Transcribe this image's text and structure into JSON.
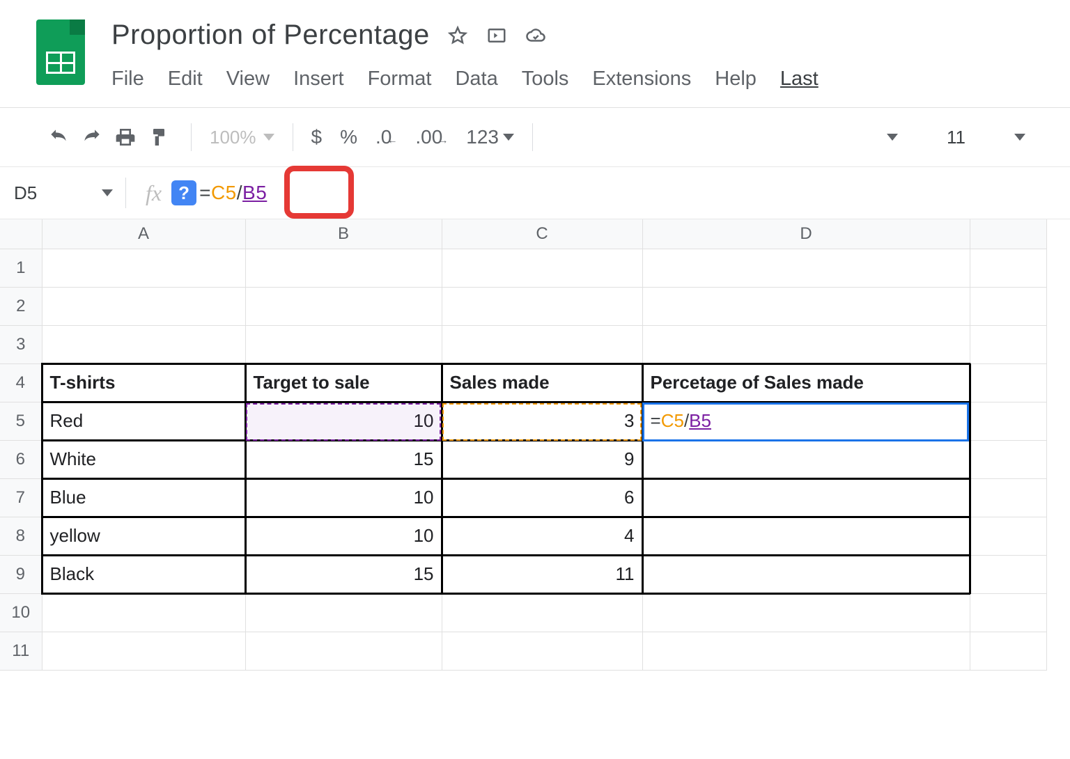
{
  "doc": {
    "title": "Proportion of Percentage"
  },
  "menu": {
    "file": "File",
    "edit": "Edit",
    "view": "View",
    "insert": "Insert",
    "format": "Format",
    "data": "Data",
    "tools": "Tools",
    "extensions": "Extensions",
    "help": "Help",
    "last": "Last"
  },
  "toolbar": {
    "zoom": "100%",
    "currency": "$",
    "percent": "%",
    "dec_dec": ".0",
    "inc_dec": ".00",
    "numfmt": "123",
    "fontsize": "11"
  },
  "namebox": "D5",
  "formula": {
    "eq": "=",
    "ref1": "C5",
    "slash": "/",
    "ref2": "B5"
  },
  "columns": [
    "A",
    "B",
    "C",
    "D"
  ],
  "rows": [
    "1",
    "2",
    "3",
    "4",
    "5",
    "6",
    "7",
    "8",
    "9",
    "10",
    "11"
  ],
  "headers": {
    "a": "T-shirts",
    "b": "Target to sale",
    "c": "Sales made",
    "d": "Percetage of  Sales made"
  },
  "data": [
    {
      "a": "Red",
      "b": "10",
      "c": "3"
    },
    {
      "a": "White",
      "b": "15",
      "c": "9"
    },
    {
      "a": "Blue",
      "b": "10",
      "c": "6"
    },
    {
      "a": "yellow",
      "b": "10",
      "c": "4"
    },
    {
      "a": "Black",
      "b": "15",
      "c": "11"
    }
  ],
  "cell_formula": {
    "eq": "=",
    "ref1": "C5",
    "slash": "/",
    "ref2": "B5"
  }
}
